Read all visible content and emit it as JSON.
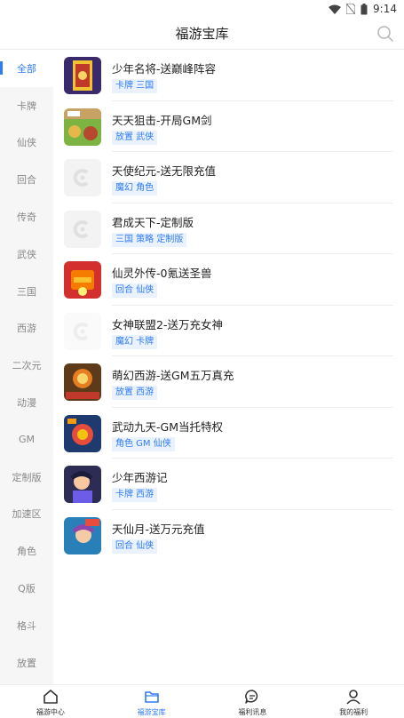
{
  "status": {
    "time": "9:14"
  },
  "header": {
    "title": "福游宝库"
  },
  "sidebar": {
    "items": [
      {
        "label": "全部",
        "active": true
      },
      {
        "label": "卡牌"
      },
      {
        "label": "仙侠"
      },
      {
        "label": "回合"
      },
      {
        "label": "传奇"
      },
      {
        "label": "武侠"
      },
      {
        "label": "三国"
      },
      {
        "label": "西游"
      },
      {
        "label": "二次元"
      },
      {
        "label": "动漫"
      },
      {
        "label": "GM"
      },
      {
        "label": "定制版"
      },
      {
        "label": "加速区"
      },
      {
        "label": "角色"
      },
      {
        "label": "Q版"
      },
      {
        "label": "格斗"
      },
      {
        "label": "放置"
      }
    ]
  },
  "games": [
    {
      "name": "少年名将-送巅峰阵容",
      "tags": "卡牌 三国",
      "icon": "game-icon-shaonian-mingjiang"
    },
    {
      "name": "天天狙击-开局GM剑",
      "tags": "放置 武侠",
      "icon": "game-icon-tiantian-juji"
    },
    {
      "name": "天使纪元-送无限充值",
      "tags": "魔幻 角色",
      "icon": "game-icon-placeholder"
    },
    {
      "name": "君成天下-定制版",
      "tags": "三国 策略 定制版",
      "icon": "game-icon-placeholder"
    },
    {
      "name": "仙灵外传-0氪送圣兽",
      "tags": "回合 仙侠",
      "icon": "game-icon-xianling-waizhuan"
    },
    {
      "name": "女神联盟2-送万充女神",
      "tags": "魔幻 卡牌",
      "icon": "game-icon-placeholder"
    },
    {
      "name": "萌幻西游-送GM五万真充",
      "tags": "放置 西游",
      "icon": "game-icon-menghuan-xiyou"
    },
    {
      "name": "武动九天-GM当托特权",
      "tags": "角色 GM 仙侠",
      "icon": "game-icon-wudong-jiutian"
    },
    {
      "name": "少年西游记",
      "tags": "卡牌 西游",
      "icon": "game-icon-shaonian-xiyouji"
    },
    {
      "name": "天仙月-送万元充值",
      "tags": "回合 仙侠",
      "icon": "game-icon-tianxianyue"
    }
  ],
  "tabbar": {
    "items": [
      {
        "label": "福游中心",
        "icon": "home-icon"
      },
      {
        "label": "福游宝库",
        "icon": "folder-icon",
        "active": true
      },
      {
        "label": "福利讯息",
        "icon": "chat-icon"
      },
      {
        "label": "我的福利",
        "icon": "user-icon"
      }
    ]
  },
  "colors": {
    "accent": "#2f7bf5",
    "tag_bg": "#eaf2fe",
    "sidebar_bg": "#f6f6f6"
  }
}
